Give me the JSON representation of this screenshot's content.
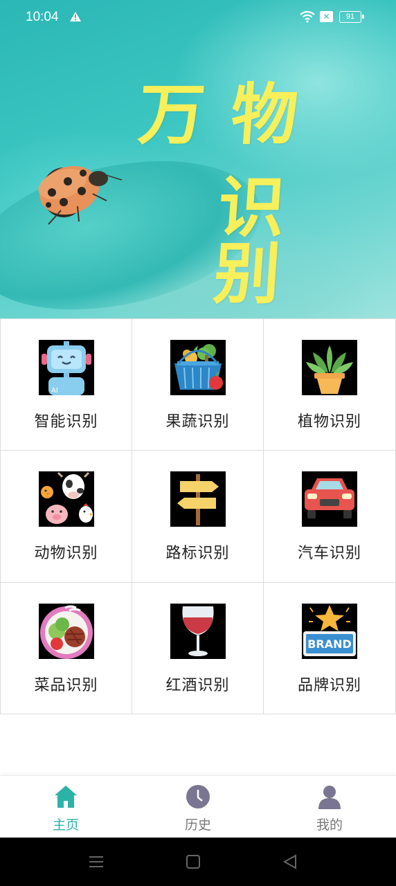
{
  "status_bar": {
    "time": "10:04",
    "battery": "91",
    "icons": [
      "warning-icon",
      "wifi-icon",
      "sim-off-icon",
      "battery-icon"
    ]
  },
  "banner": {
    "line1": "万物",
    "line2": "识别",
    "text_color": "#f7f05a",
    "background_color": "#3cc6c2"
  },
  "grid": {
    "items": [
      {
        "label": "智能识别",
        "icon": "ai-robot-icon"
      },
      {
        "label": "果蔬识别",
        "icon": "fruit-basket-icon"
      },
      {
        "label": "植物识别",
        "icon": "potted-plant-icon"
      },
      {
        "label": "动物识别",
        "icon": "animals-icon"
      },
      {
        "label": "路标识别",
        "icon": "signpost-icon"
      },
      {
        "label": "汽车识别",
        "icon": "car-icon"
      },
      {
        "label": "菜品识别",
        "icon": "dish-plate-icon"
      },
      {
        "label": "红酒识别",
        "icon": "wine-glass-icon"
      },
      {
        "label": "品牌识别",
        "icon": "brand-star-icon"
      }
    ],
    "brand_icon_text": "BRAND"
  },
  "bottom_nav": {
    "items": [
      {
        "label": "主页",
        "icon": "home-icon",
        "active": true
      },
      {
        "label": "历史",
        "icon": "clock-icon",
        "active": false
      },
      {
        "label": "我的",
        "icon": "user-icon",
        "active": false
      }
    ],
    "active_color": "#2bb3a8",
    "inactive_color": "#777777"
  },
  "system_nav": {
    "buttons": [
      "menu-icon",
      "home-square-icon",
      "back-triangle-icon"
    ]
  }
}
